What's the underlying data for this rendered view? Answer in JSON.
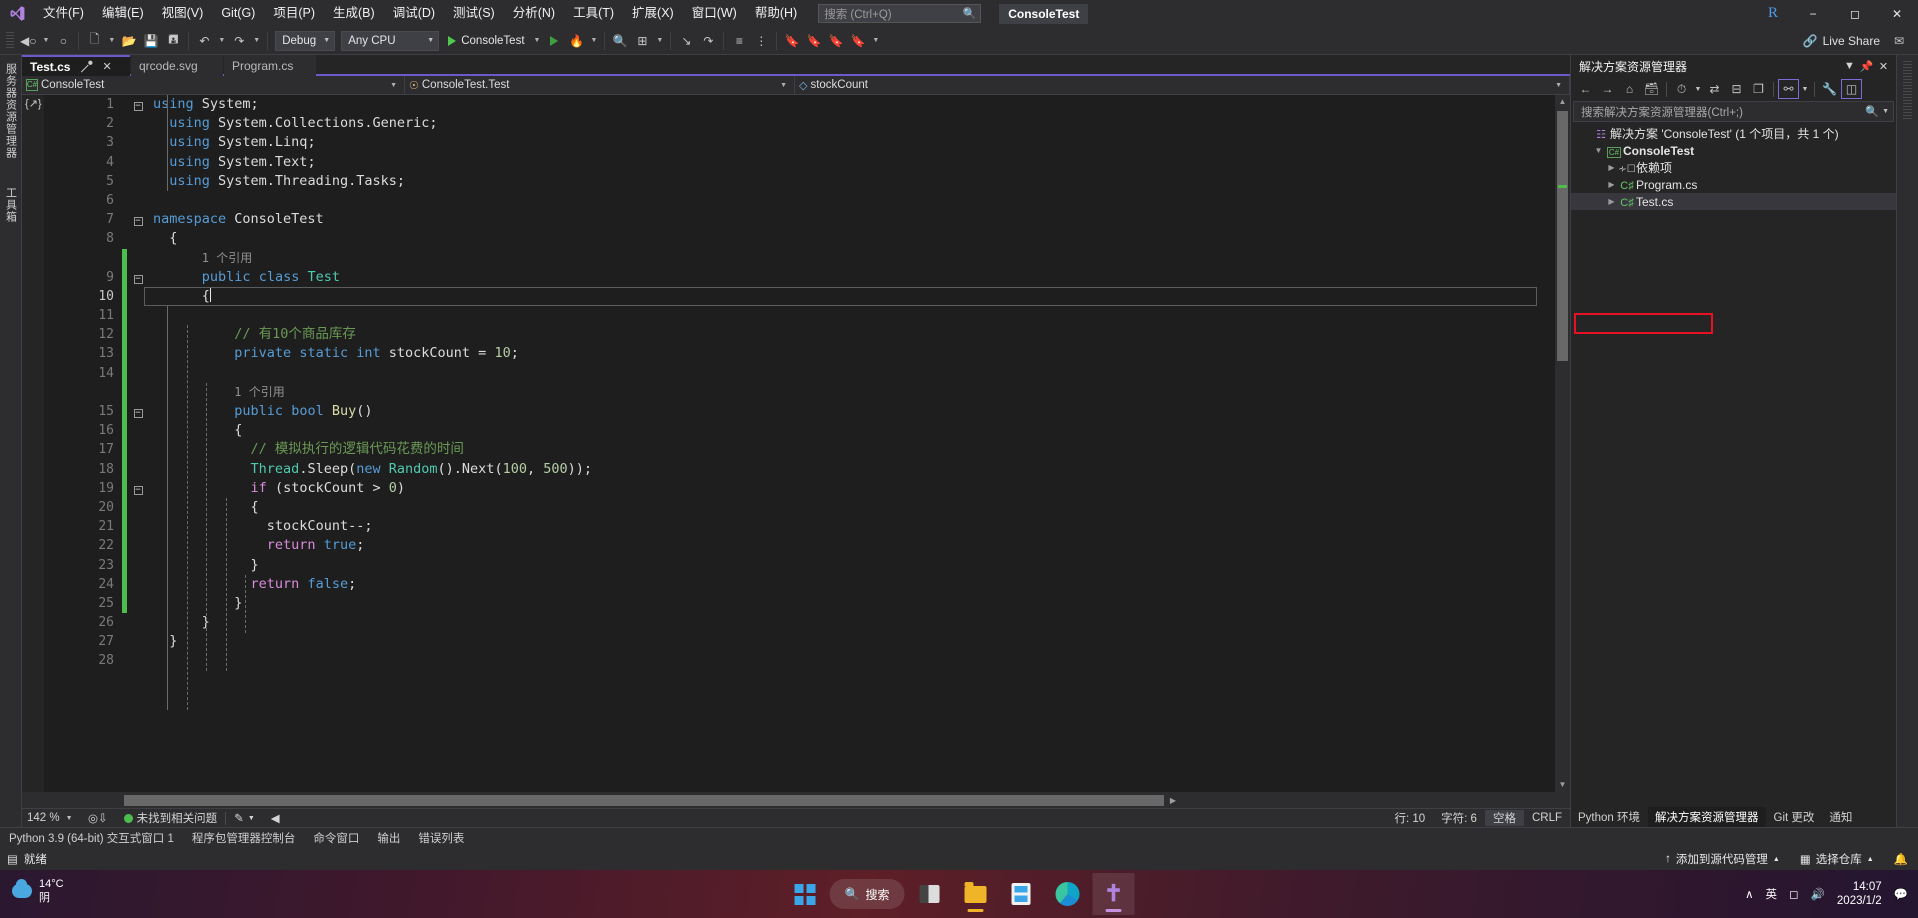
{
  "titlebar": {
    "logo_icon": "visual-studio-logo",
    "menus": [
      "文件(F)",
      "编辑(E)",
      "视图(V)",
      "Git(G)",
      "项目(P)",
      "生成(B)",
      "调试(D)",
      "测试(S)",
      "分析(N)",
      "工具(T)",
      "扩展(X)",
      "窗口(W)",
      "帮助(H)"
    ],
    "search_placeholder": "搜索 (Ctrl+Q)",
    "search_icon": "magnifier-icon",
    "project_chip": "ConsoleTest",
    "account_badge": "R",
    "minimize_icon": "minimize-icon",
    "restore_icon": "restore-icon",
    "close_icon": "close-icon"
  },
  "toolbar": {
    "nav_back_icon": "navigate-back-icon",
    "nav_forward_icon": "navigate-forward-icon",
    "new_project_icon": "new-project-icon",
    "open_icon": "open-folder-icon",
    "save_icon": "save-icon",
    "save_all_icon": "save-all-icon",
    "undo_icon": "undo-icon",
    "redo_icon": "redo-icon",
    "config_value": "Debug",
    "platform_value": "Any CPU",
    "run_label": "ConsoleTest",
    "run_icon": "play-icon",
    "run_no_debug_icon": "play-outline-icon",
    "hotreload_icon": "hot-reload-icon",
    "live_share_label": "Live Share",
    "live_share_icon": "live-share-icon",
    "feedback_icon": "feedback-icon"
  },
  "left_rail": {
    "label": "服务器资源管理器",
    "label2": "工具箱"
  },
  "editor": {
    "tabs": [
      {
        "label": "Test.cs",
        "active": true,
        "pin_icon": "pin-icon",
        "close_icon": "close-icon"
      },
      {
        "label": "qrcode.svg",
        "active": false
      },
      {
        "label": "Program.cs",
        "active": false
      }
    ],
    "navbar": [
      {
        "icon": "csharp-project-icon",
        "label": "ConsoleTest"
      },
      {
        "icon": "class-icon",
        "label": "ConsoleTest.Test"
      },
      {
        "icon": "field-icon",
        "label": "stockCount"
      }
    ],
    "code_lines": [
      {
        "n": "1",
        "fold": "minus",
        "change": false,
        "indent": 0,
        "tokens": [
          [
            "kw",
            "using"
          ],
          [
            "id",
            " System;"
          ]
        ]
      },
      {
        "n": "2",
        "fold": "",
        "change": false,
        "indent": 1,
        "tokens": [
          [
            "kw",
            "using"
          ],
          [
            "id",
            " System.Collections.Generic;"
          ]
        ]
      },
      {
        "n": "3",
        "fold": "",
        "change": false,
        "indent": 1,
        "tokens": [
          [
            "kw",
            "using"
          ],
          [
            "id",
            " System.Linq;"
          ]
        ]
      },
      {
        "n": "4",
        "fold": "",
        "change": false,
        "indent": 1,
        "tokens": [
          [
            "kw",
            "using"
          ],
          [
            "id",
            " System.Text;"
          ]
        ]
      },
      {
        "n": "5",
        "fold": "",
        "change": false,
        "indent": 1,
        "tokens": [
          [
            "kw",
            "using"
          ],
          [
            "id",
            " System.Threading.Tasks;"
          ]
        ]
      },
      {
        "n": "6",
        "fold": "",
        "change": false,
        "indent": 0,
        "tokens": []
      },
      {
        "n": "7",
        "fold": "minus",
        "change": false,
        "indent": 0,
        "tokens": [
          [
            "kw",
            "namespace"
          ],
          [
            "id",
            " ConsoleTest"
          ]
        ]
      },
      {
        "n": "8",
        "fold": "",
        "change": false,
        "indent": 1,
        "tokens": [
          [
            "id",
            "{"
          ]
        ]
      },
      {
        "n": "",
        "fold": "",
        "change": true,
        "indent": 3,
        "tokens": [
          [
            "ref",
            "1 个引用"
          ]
        ]
      },
      {
        "n": "9",
        "fold": "minus",
        "change": true,
        "indent": 3,
        "tokens": [
          [
            "kw",
            "public"
          ],
          [
            "id",
            " "
          ],
          [
            "kw",
            "class"
          ],
          [
            "id",
            " "
          ],
          [
            "typ",
            "Test"
          ]
        ]
      },
      {
        "n": "10",
        "fold": "",
        "change": true,
        "indent": 3,
        "cursor": true,
        "tokens": [
          [
            "id",
            "{"
          ]
        ]
      },
      {
        "n": "11",
        "fold": "",
        "change": true,
        "indent": 3,
        "tokens": []
      },
      {
        "n": "12",
        "fold": "",
        "change": true,
        "indent": 5,
        "tokens": [
          [
            "cmt",
            "// 有10个商品库存"
          ]
        ]
      },
      {
        "n": "13",
        "fold": "",
        "change": true,
        "indent": 5,
        "tokens": [
          [
            "kw",
            "private"
          ],
          [
            "id",
            " "
          ],
          [
            "kw",
            "static"
          ],
          [
            "id",
            " "
          ],
          [
            "kw",
            "int"
          ],
          [
            "id",
            " stockCount = "
          ],
          [
            "num",
            "10"
          ],
          [
            "id",
            ";"
          ]
        ]
      },
      {
        "n": "14",
        "fold": "",
        "change": true,
        "indent": 5,
        "tokens": []
      },
      {
        "n": "",
        "fold": "",
        "change": true,
        "indent": 5,
        "tokens": [
          [
            "ref",
            "1 个引用"
          ]
        ]
      },
      {
        "n": "15",
        "fold": "minus",
        "change": true,
        "indent": 5,
        "tokens": [
          [
            "kw",
            "public"
          ],
          [
            "id",
            " "
          ],
          [
            "kw",
            "bool"
          ],
          [
            "id",
            " "
          ],
          [
            "fn",
            "Buy"
          ],
          [
            "id",
            "()"
          ]
        ]
      },
      {
        "n": "16",
        "fold": "",
        "change": true,
        "indent": 5,
        "tokens": [
          [
            "id",
            "{"
          ]
        ]
      },
      {
        "n": "17",
        "fold": "",
        "change": true,
        "indent": 6,
        "tokens": [
          [
            "cmt",
            "// 模拟执行的逻辑代码花费的时间"
          ]
        ]
      },
      {
        "n": "18",
        "fold": "",
        "change": true,
        "indent": 6,
        "tokens": [
          [
            "typ",
            "Thread"
          ],
          [
            "id",
            ".Sleep("
          ],
          [
            "kw",
            "new"
          ],
          [
            "id",
            " "
          ],
          [
            "typ",
            "Random"
          ],
          [
            "id",
            "().Next("
          ],
          [
            "num",
            "100"
          ],
          [
            "id",
            ", "
          ],
          [
            "num",
            "500"
          ],
          [
            "id",
            "));"
          ]
        ]
      },
      {
        "n": "19",
        "fold": "minus",
        "change": true,
        "indent": 6,
        "tokens": [
          [
            "kw2",
            "if"
          ],
          [
            "id",
            " (stockCount "
          ],
          [
            "id",
            ">"
          ],
          [
            "id",
            " "
          ],
          [
            "num",
            "0"
          ],
          [
            "id",
            ")"
          ]
        ]
      },
      {
        "n": "20",
        "fold": "",
        "change": true,
        "indent": 6,
        "tokens": [
          [
            "id",
            "{"
          ]
        ]
      },
      {
        "n": "21",
        "fold": "",
        "change": true,
        "indent": 7,
        "tokens": [
          [
            "id",
            "stockCount--;"
          ]
        ]
      },
      {
        "n": "22",
        "fold": "",
        "change": true,
        "indent": 7,
        "tokens": [
          [
            "kw2",
            "return"
          ],
          [
            "id",
            " "
          ],
          [
            "kw",
            "true"
          ],
          [
            "id",
            ";"
          ]
        ]
      },
      {
        "n": "23",
        "fold": "",
        "change": true,
        "indent": 6,
        "tokens": [
          [
            "id",
            "}"
          ]
        ]
      },
      {
        "n": "24",
        "fold": "",
        "change": true,
        "indent": 6,
        "tokens": [
          [
            "kw2",
            "return"
          ],
          [
            "id",
            " "
          ],
          [
            "kw",
            "false"
          ],
          [
            "id",
            ";"
          ]
        ]
      },
      {
        "n": "25",
        "fold": "",
        "change": true,
        "indent": 5,
        "tokens": [
          [
            "id",
            "}"
          ]
        ]
      },
      {
        "n": "26",
        "fold": "",
        "change": false,
        "indent": 3,
        "tokens": [
          [
            "id",
            "}"
          ]
        ]
      },
      {
        "n": "27",
        "fold": "",
        "change": false,
        "indent": 1,
        "tokens": [
          [
            "id",
            "}"
          ]
        ]
      },
      {
        "n": "28",
        "fold": "",
        "change": false,
        "indent": 0,
        "tokens": []
      }
    ],
    "status": {
      "zoom": "142 %",
      "issues_label": "未找到相关问题",
      "issues_icon": "check-circle-icon",
      "pen_icon": "pen-icon",
      "line_label": "行: 10",
      "col_label": "字符: 6",
      "spaces_label": "空格",
      "eol_label": "CRLF"
    }
  },
  "solution_explorer": {
    "title": "解决方案资源管理器",
    "dropdown_icon": "chevron-down-icon",
    "pin_icon": "pin-icon",
    "close_icon": "close-icon",
    "toolbar_icons": [
      "back-icon",
      "forward-icon",
      "home-icon",
      "pending-changes-icon",
      "history-icon",
      "sync-icon",
      "collapse-all-icon",
      "show-all-files-icon",
      "preview-selected-icon",
      "properties-icon",
      "switch-views-icon"
    ],
    "search_placeholder": "搜索解决方案资源管理器(Ctrl+;)",
    "search_icon": "magnifier-icon",
    "tree": [
      {
        "label": "解决方案 'ConsoleTest' (1 个项目，共 1 个)",
        "icon": "solution-icon",
        "indent": 0,
        "arrow": "",
        "bold": false
      },
      {
        "label": "ConsoleTest",
        "icon": "csharp-project-icon",
        "indent": 1,
        "arrow": "expanded",
        "bold": true
      },
      {
        "label": "依赖项",
        "icon": "dependencies-icon",
        "indent": 2,
        "arrow": "collapsed",
        "bold": false
      },
      {
        "label": "Program.cs",
        "icon": "csharp-file-icon",
        "indent": 2,
        "arrow": "collapsed",
        "bold": false
      },
      {
        "label": "Test.cs",
        "icon": "csharp-file-icon",
        "indent": 2,
        "arrow": "collapsed",
        "bold": false,
        "selected": true,
        "highlight": "#e81123"
      }
    ],
    "footer_tabs": [
      {
        "label": "Python 环境",
        "active": false
      },
      {
        "label": "解决方案资源管理器",
        "active": true
      },
      {
        "label": "Git 更改",
        "active": false
      },
      {
        "label": "通知",
        "active": false
      }
    ]
  },
  "bottom_panels": {
    "tabs": [
      "Python 3.9 (64-bit) 交互式窗口 1",
      "程序包管理器控制台",
      "命令窗口",
      "输出",
      "错误列表"
    ]
  },
  "vs_status": {
    "ready_icon": "ready-icon",
    "ready_label": "就绪",
    "add_source_control_label": "添加到源代码管理",
    "add_source_control_icon": "arrow-up-icon",
    "select_repo_label": "选择仓库",
    "select_repo_icon": "repo-icon",
    "bell_icon": "bell-icon"
  },
  "taskbar": {
    "weather_temp": "14°C",
    "weather_desc": "阴",
    "weather_icon": "cloud-icon",
    "start_icon": "windows-start-icon",
    "search_label": "搜索",
    "search_icon": "magnifier-icon",
    "apps": [
      "task-view-icon",
      "file-explorer-icon",
      "store-icon",
      "edge-icon",
      "visual-studio-icon"
    ],
    "tray_chevron_icon": "chevron-up-icon",
    "ime_label": "英",
    "network_icon": "network-icon",
    "volume_icon": "volume-icon",
    "clock_time": "14:07",
    "clock_date": "2023/1/2",
    "notify_icon": "notification-icon"
  }
}
